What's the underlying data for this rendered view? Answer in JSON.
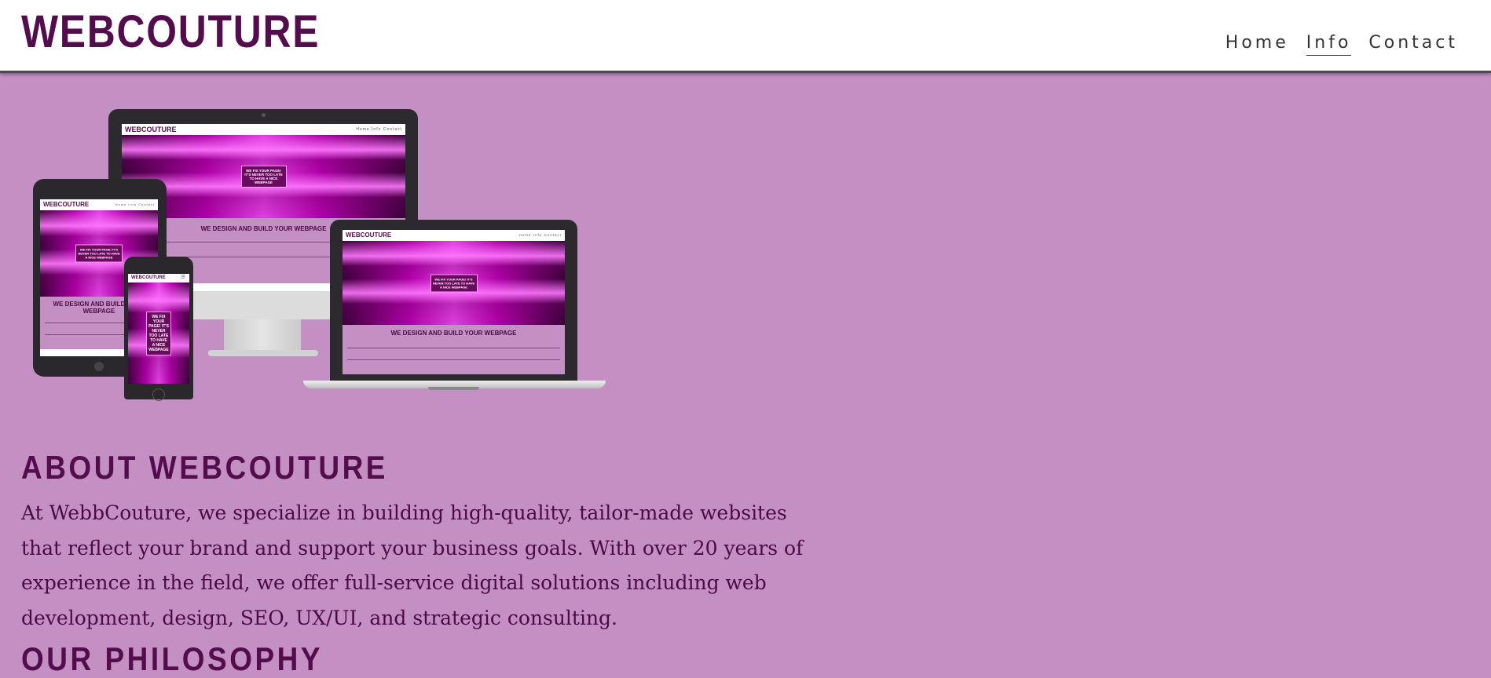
{
  "header": {
    "logo": "WEBCOUTURE",
    "nav": [
      {
        "label": "Home",
        "active": false
      },
      {
        "label": "Info",
        "active": true
      },
      {
        "label": "Contact",
        "active": false
      }
    ]
  },
  "hero": {
    "mockup": {
      "logo": "WEBCOUTURE",
      "nav": "Home  Info  Contact",
      "hero_box": "WE FIX YOUR PAGE! IT'S NEVER TOO LATE TO HAVE A NICE WEBPAGE",
      "heading": "WE DESIGN AND BUILD YOUR WEBPAGE"
    }
  },
  "about": {
    "title": "ABOUT WEBCOUTURE",
    "text": "At WebbCouture, we specialize in building high-quality, tailor-made websites that reflect your brand and support your business goals. With over 20 years of experience in the field, we offer full-service digital solutions including web development, design, SEO, UX/UI, and strategic consulting."
  },
  "philosophy": {
    "title": "OUR PHILOSOPHY"
  },
  "colors": {
    "brand": "#530c4c",
    "background": "#c48fc3",
    "header_bg": "#ffffff"
  }
}
